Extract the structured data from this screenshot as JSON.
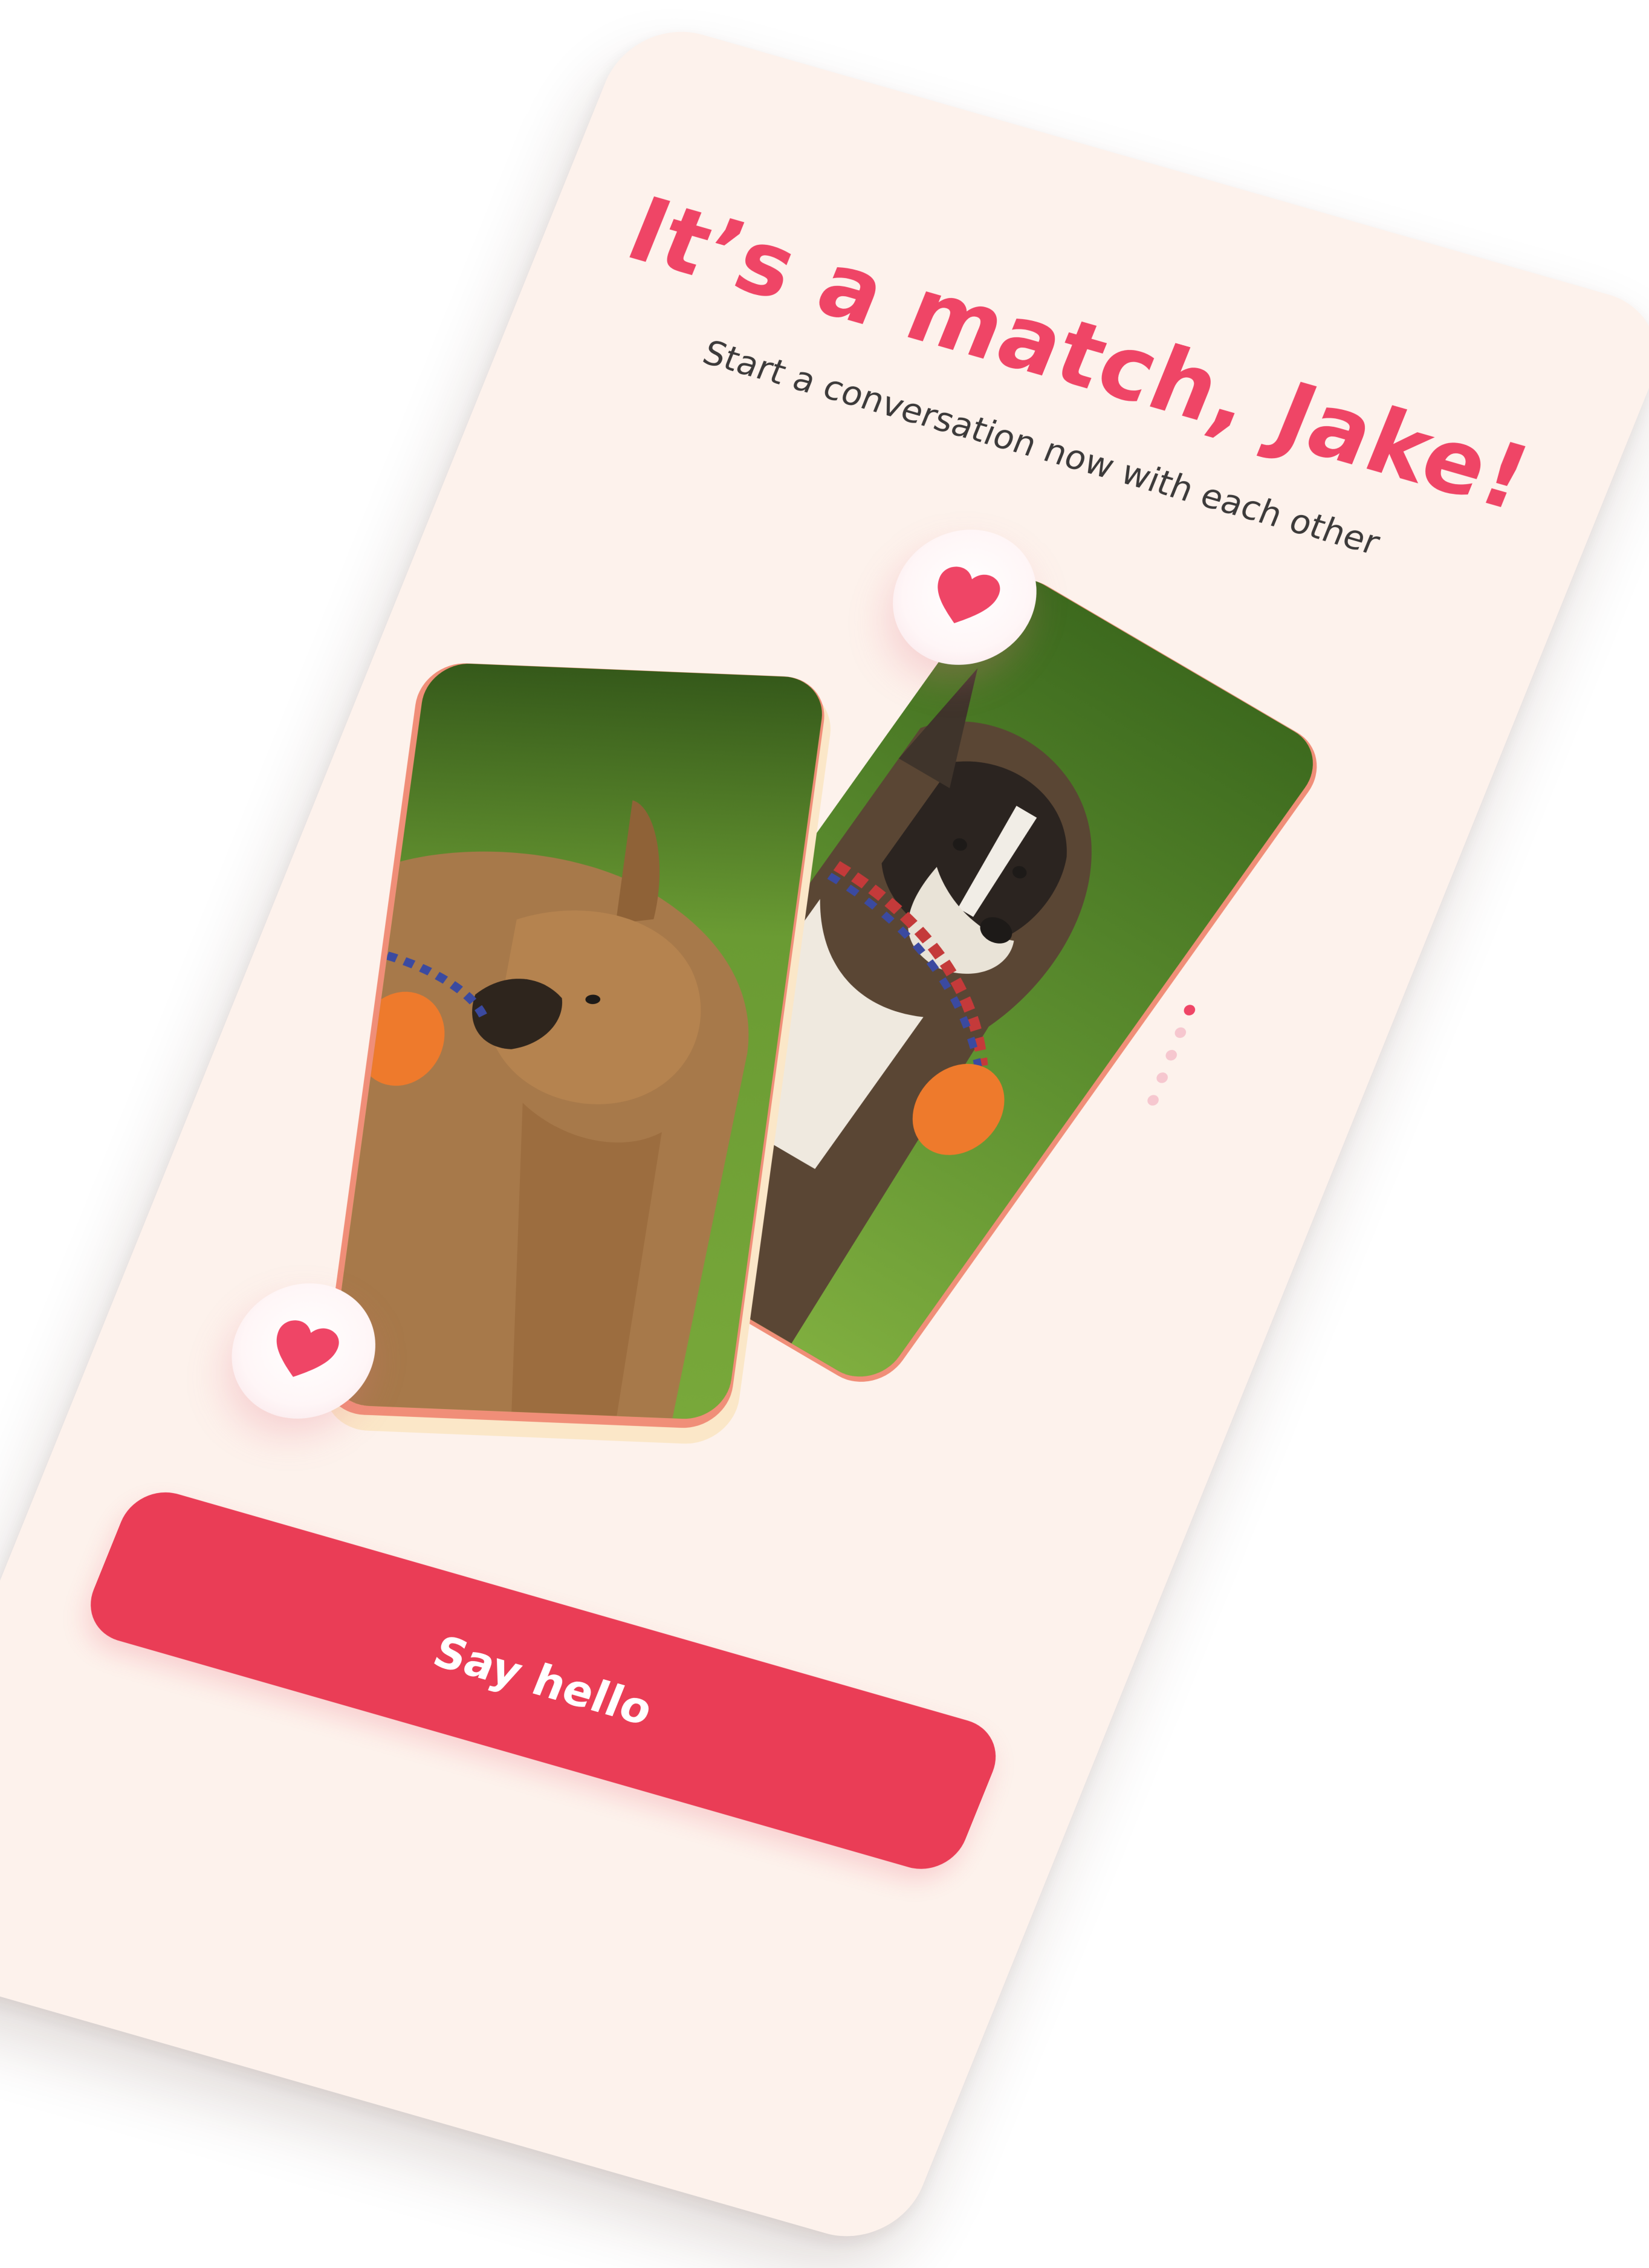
{
  "match_screen": {
    "title": "It’s a match, Jake!",
    "subtitle": "Start a conversation now with each other",
    "cta_label": "Say hello",
    "pagination": {
      "total": 5,
      "active_index": 0
    }
  },
  "colors": {
    "accent": "#ef4566",
    "button": "#ea3d56",
    "screen_background": "#fdf2ec",
    "card_frame": "#f08e78",
    "subtitle_text": "#3c3a3a"
  },
  "icons": {
    "badge_icon": "heart-icon"
  }
}
